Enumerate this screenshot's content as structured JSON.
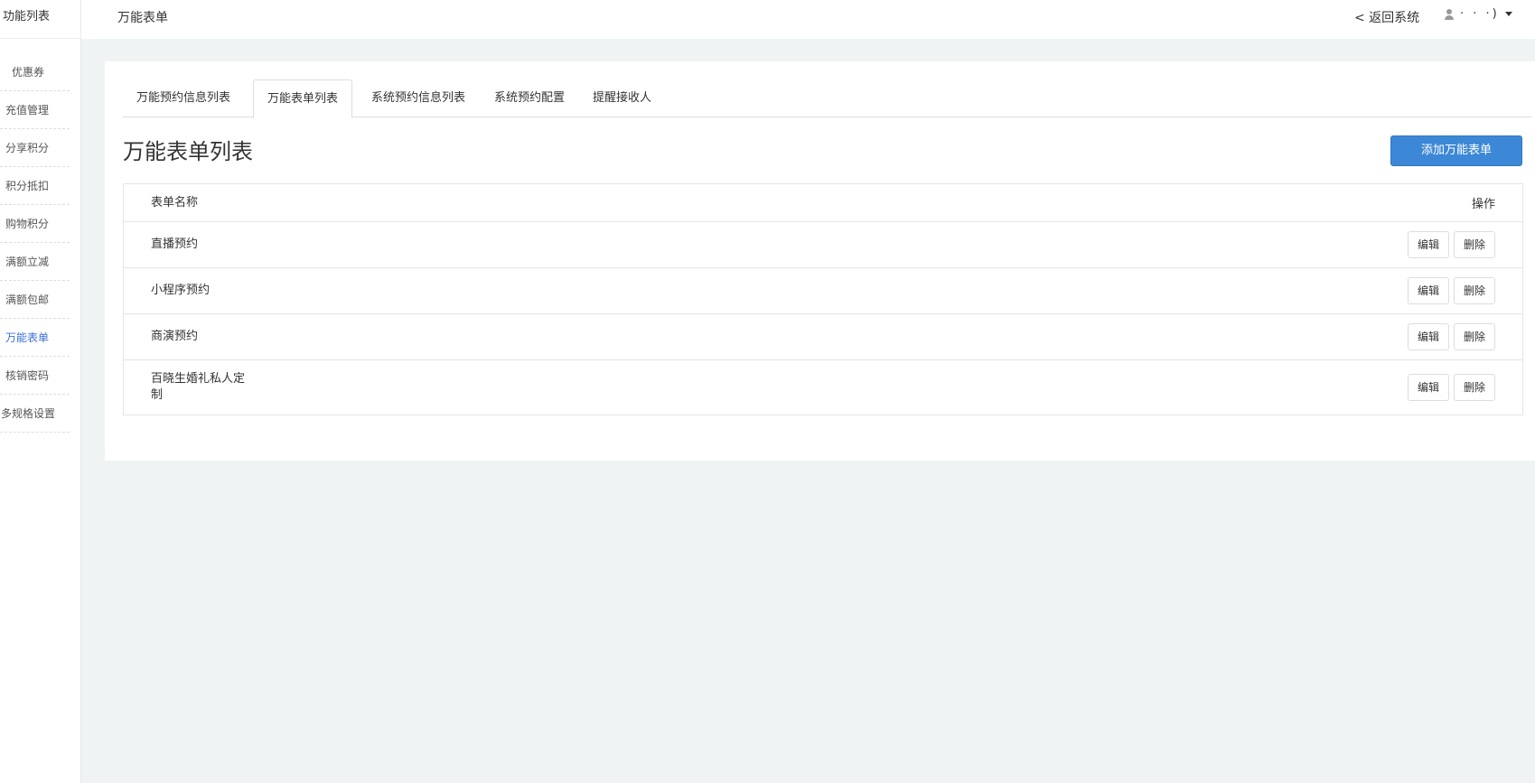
{
  "sidebar": {
    "title": "功能列表",
    "items": [
      {
        "label": "优惠券"
      },
      {
        "label": "充值管理"
      },
      {
        "label": "分享积分"
      },
      {
        "label": "积分抵扣"
      },
      {
        "label": "购物积分"
      },
      {
        "label": "满额立减"
      },
      {
        "label": "满额包邮"
      },
      {
        "label": "万能表单",
        "active": true
      },
      {
        "label": "核销密码"
      },
      {
        "label": "多规格设置"
      }
    ]
  },
  "header": {
    "title": "万能表单",
    "back_label": "< 返回系统",
    "user_name": "· ·   ·)",
    "user_icon": "person-icon",
    "caret_icon": "caret-down-icon"
  },
  "tabs": [
    {
      "label": "万能预约信息列表"
    },
    {
      "label": "万能表单列表",
      "active": true
    },
    {
      "label": "系统预约信息列表"
    },
    {
      "label": "系统预约配置"
    },
    {
      "label": "提醒接收人"
    }
  ],
  "main": {
    "title": "万能表单列表",
    "add_button": "添加万能表单",
    "accent_color": "#3d88d6"
  },
  "table": {
    "columns": [
      "表单名称",
      "操作"
    ],
    "rows": [
      {
        "name": "直播预约",
        "edit": "编辑",
        "delete": "删除"
      },
      {
        "name": "小程序预约",
        "edit": "编辑",
        "delete": "删除"
      },
      {
        "name": "商演预约",
        "edit": "编辑",
        "delete": "删除"
      },
      {
        "name": "百晓生婚礼私人定制",
        "edit": "编辑",
        "delete": "删除"
      }
    ]
  }
}
